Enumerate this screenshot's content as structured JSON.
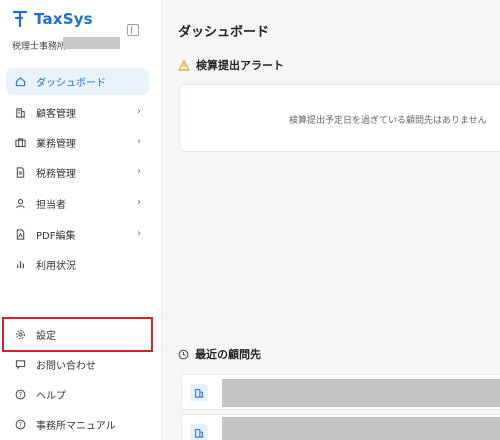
{
  "app": {
    "name": "TaxSys",
    "office_label": "税理士事務所"
  },
  "sidebar": {
    "items": [
      {
        "label": "ダッシュボード",
        "icon": "home-icon",
        "active": true,
        "chevron": false
      },
      {
        "label": "顧客管理",
        "icon": "building-icon",
        "active": false,
        "chevron": true
      },
      {
        "label": "業務管理",
        "icon": "briefcase-icon",
        "active": false,
        "chevron": true
      },
      {
        "label": "税務管理",
        "icon": "document-icon",
        "active": false,
        "chevron": true
      },
      {
        "label": "担当者",
        "icon": "person-icon",
        "active": false,
        "chevron": true
      },
      {
        "label": "PDF編集",
        "icon": "pdf-icon",
        "active": false,
        "chevron": true
      },
      {
        "label": "利用状況",
        "icon": "bar-chart-icon",
        "active": false,
        "chevron": false
      }
    ],
    "bottom_items": [
      {
        "label": "設定",
        "icon": "gear-icon"
      },
      {
        "label": "お問い合わせ",
        "icon": "chat-icon"
      },
      {
        "label": "ヘルプ",
        "icon": "help-icon"
      },
      {
        "label": "事務所マニュアル",
        "icon": "help-icon"
      }
    ]
  },
  "main": {
    "title": "ダッシュボード",
    "alert": {
      "title": "検算提出アラート",
      "icon": "warning-icon",
      "empty_message": "検算提出予定日を過ぎている顧問先はありません"
    },
    "recent": {
      "title": "最近の顧問先",
      "icon": "clock-icon"
    }
  },
  "colors": {
    "accent": "#1f6fd6",
    "highlight": "#d8202a",
    "warning": "#f0a020"
  }
}
